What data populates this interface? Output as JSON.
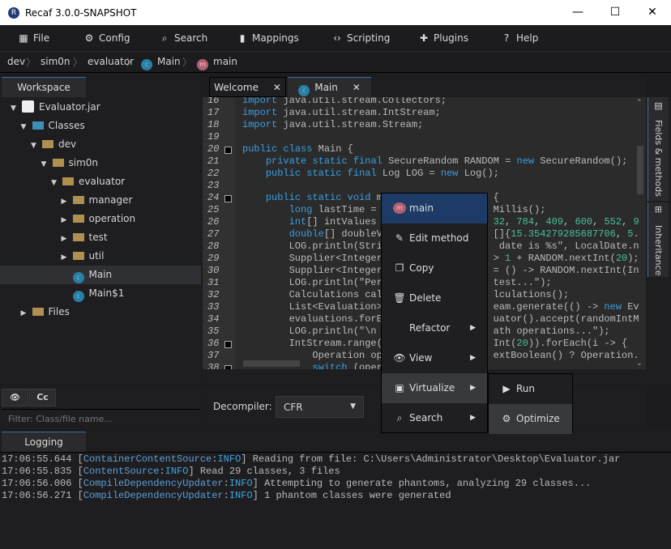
{
  "window": {
    "title": "Recaf 3.0.0-SNAPSHOT",
    "minimize": "—",
    "maximize": "☐",
    "close": "✕"
  },
  "menu": [
    {
      "label": "File",
      "icon": "grid-icon",
      "glyph": "▦"
    },
    {
      "label": "Config",
      "icon": "gear-icon",
      "glyph": "⚙"
    },
    {
      "label": "Search",
      "icon": "search-icon",
      "glyph": "⌕"
    },
    {
      "label": "Mappings",
      "icon": "book-icon",
      "glyph": "▮"
    },
    {
      "label": "Scripting",
      "icon": "code-icon",
      "glyph": "‹›"
    },
    {
      "label": "Plugins",
      "icon": "puzzle-icon",
      "glyph": "✚"
    },
    {
      "label": "Help",
      "icon": "help-icon",
      "glyph": "?"
    }
  ],
  "breadcrumb": [
    "dev",
    "sim0n",
    "evaluator",
    "Main",
    "main"
  ],
  "workspace": {
    "tab": "Workspace",
    "tree": [
      {
        "label": "Evaluator.jar",
        "level": 0,
        "expanded": true,
        "type": "jar"
      },
      {
        "label": "Classes",
        "level": 1,
        "expanded": true,
        "type": "classes"
      },
      {
        "label": "dev",
        "level": 2,
        "expanded": true,
        "type": "package"
      },
      {
        "label": "sim0n",
        "level": 3,
        "expanded": true,
        "type": "package"
      },
      {
        "label": "evaluator",
        "level": 4,
        "expanded": true,
        "type": "package"
      },
      {
        "label": "manager",
        "level": 5,
        "expanded": false,
        "type": "package"
      },
      {
        "label": "operation",
        "level": 5,
        "expanded": false,
        "type": "package"
      },
      {
        "label": "test",
        "level": 5,
        "expanded": false,
        "type": "package"
      },
      {
        "label": "util",
        "level": 5,
        "expanded": false,
        "type": "package"
      },
      {
        "label": "Main",
        "level": 5,
        "type": "class",
        "selected": true
      },
      {
        "label": "Main$1",
        "level": 5,
        "type": "class"
      },
      {
        "label": "Files",
        "level": 1,
        "expanded": false,
        "type": "files"
      }
    ],
    "tool_buttons": [
      "👁",
      "Cc"
    ],
    "filter_placeholder": "Filter: Class/file name..."
  },
  "editor": {
    "tabs": [
      {
        "label": "Welcome"
      },
      {
        "label": "Main",
        "active": true
      }
    ],
    "lines": [
      {
        "n": "16",
        "t": "import java.util.stream.Collectors;"
      },
      {
        "n": "17",
        "t": "import java.util.stream.IntStream;"
      },
      {
        "n": "18",
        "t": "import java.util.stream.Stream;"
      },
      {
        "n": "19",
        "t": ""
      },
      {
        "n": "20",
        "t": "public class Main {",
        "fold": true
      },
      {
        "n": "21",
        "t": "    private static final SecureRandom RANDOM = new SecureRandom();"
      },
      {
        "n": "22",
        "t": "    public static final Log LOG = new Log();"
      },
      {
        "n": "23",
        "t": ""
      },
      {
        "n": "24",
        "t": "    public static void m",
        "r": "{",
        "fold": true
      },
      {
        "n": "25",
        "t": "        long lastTime = ",
        "r": "Millis();"
      },
      {
        "n": "26",
        "t": "        int[] intValues ",
        "r": "32, 784, 409, 600, 552, 9"
      },
      {
        "n": "27",
        "t": "        double[] doubleV",
        "r": "[]{15.354279285687706, 5."
      },
      {
        "n": "28",
        "t": "        LOG.println(Stri",
        "r": " date is %s\", LocalDate.n"
      },
      {
        "n": "29",
        "t": "        Supplier<Integer",
        "r": "> 1 + RANDOM.nextInt(20);"
      },
      {
        "n": "30",
        "t": "        Supplier<Integer",
        "r": "= () -> RANDOM.nextInt(In"
      },
      {
        "n": "31",
        "t": "        LOG.println(\"Per",
        "r": "test...\");"
      },
      {
        "n": "32",
        "t": "        Calculations cal",
        "r": "lculations();"
      },
      {
        "n": "33",
        "t": "        List<Evaluation>",
        "r": "eam.generate(() -> new Ev"
      },
      {
        "n": "34",
        "t": "        evaluations.forE",
        "r": "uator().accept(randomIntM"
      },
      {
        "n": "35",
        "t": "        LOG.println(\"\\n",
        "r": "ath operations...\");"
      },
      {
        "n": "36",
        "t": "        IntStream.range(",
        "r": "Int(20)).forEach(i -> {",
        "fold": true
      },
      {
        "n": "37",
        "t": "            Operation op",
        "r": "extBoolean() ? Operation."
      },
      {
        "n": "38",
        "t": "            switch (oper",
        "fold": true
      }
    ],
    "side_tabs": [
      "Fields & methods",
      "Inheritance"
    ],
    "decompiler_label": "Decompiler:",
    "decompiler_value": "CFR"
  },
  "context_menu": {
    "items": [
      {
        "label": "main",
        "icon": "method-icon",
        "highlighted": true
      },
      {
        "label": "Edit method",
        "icon": "pencil-icon",
        "glyph": "✎"
      },
      {
        "label": "Copy",
        "icon": "copy-icon",
        "glyph": "❐"
      },
      {
        "label": "Delete",
        "icon": "trash-icon",
        "glyph": "🗑"
      },
      {
        "label": "Refactor",
        "submenu": true
      },
      {
        "label": "View",
        "icon": "eye-icon",
        "glyph": "👁",
        "submenu": true
      },
      {
        "label": "Virtualize",
        "icon": "virtualize-icon",
        "glyph": "▣",
        "submenu": true,
        "hover": true
      },
      {
        "label": "Search",
        "icon": "search-icon",
        "glyph": "⌕",
        "submenu": true
      }
    ],
    "submenu": [
      {
        "label": "Run",
        "icon": "play-icon",
        "glyph": "▶"
      },
      {
        "label": "Optimize",
        "icon": "gear-icon",
        "glyph": "⚙",
        "hover": true
      }
    ]
  },
  "logging": {
    "tab": "Logging",
    "lines": [
      {
        "time": "17:06:55.644",
        "src": "ContainerContentSource",
        "level": "INFO",
        "msg": "Reading from file: C:\\Users\\Administrator\\Desktop\\Evaluator.jar"
      },
      {
        "time": "17:06:55.835",
        "src": "ContentSource",
        "level": "INFO",
        "msg": "Read 29 classes, 3 files"
      },
      {
        "time": "17:06:56.006",
        "src": "CompileDependencyUpdater",
        "level": "INFO",
        "msg": "Attempting to generate phantoms, analyzing 29 classes..."
      },
      {
        "time": "17:06:56.271",
        "src": "CompileDependencyUpdater",
        "level": "INFO",
        "msg": "1 phantom classes were generated"
      }
    ]
  }
}
